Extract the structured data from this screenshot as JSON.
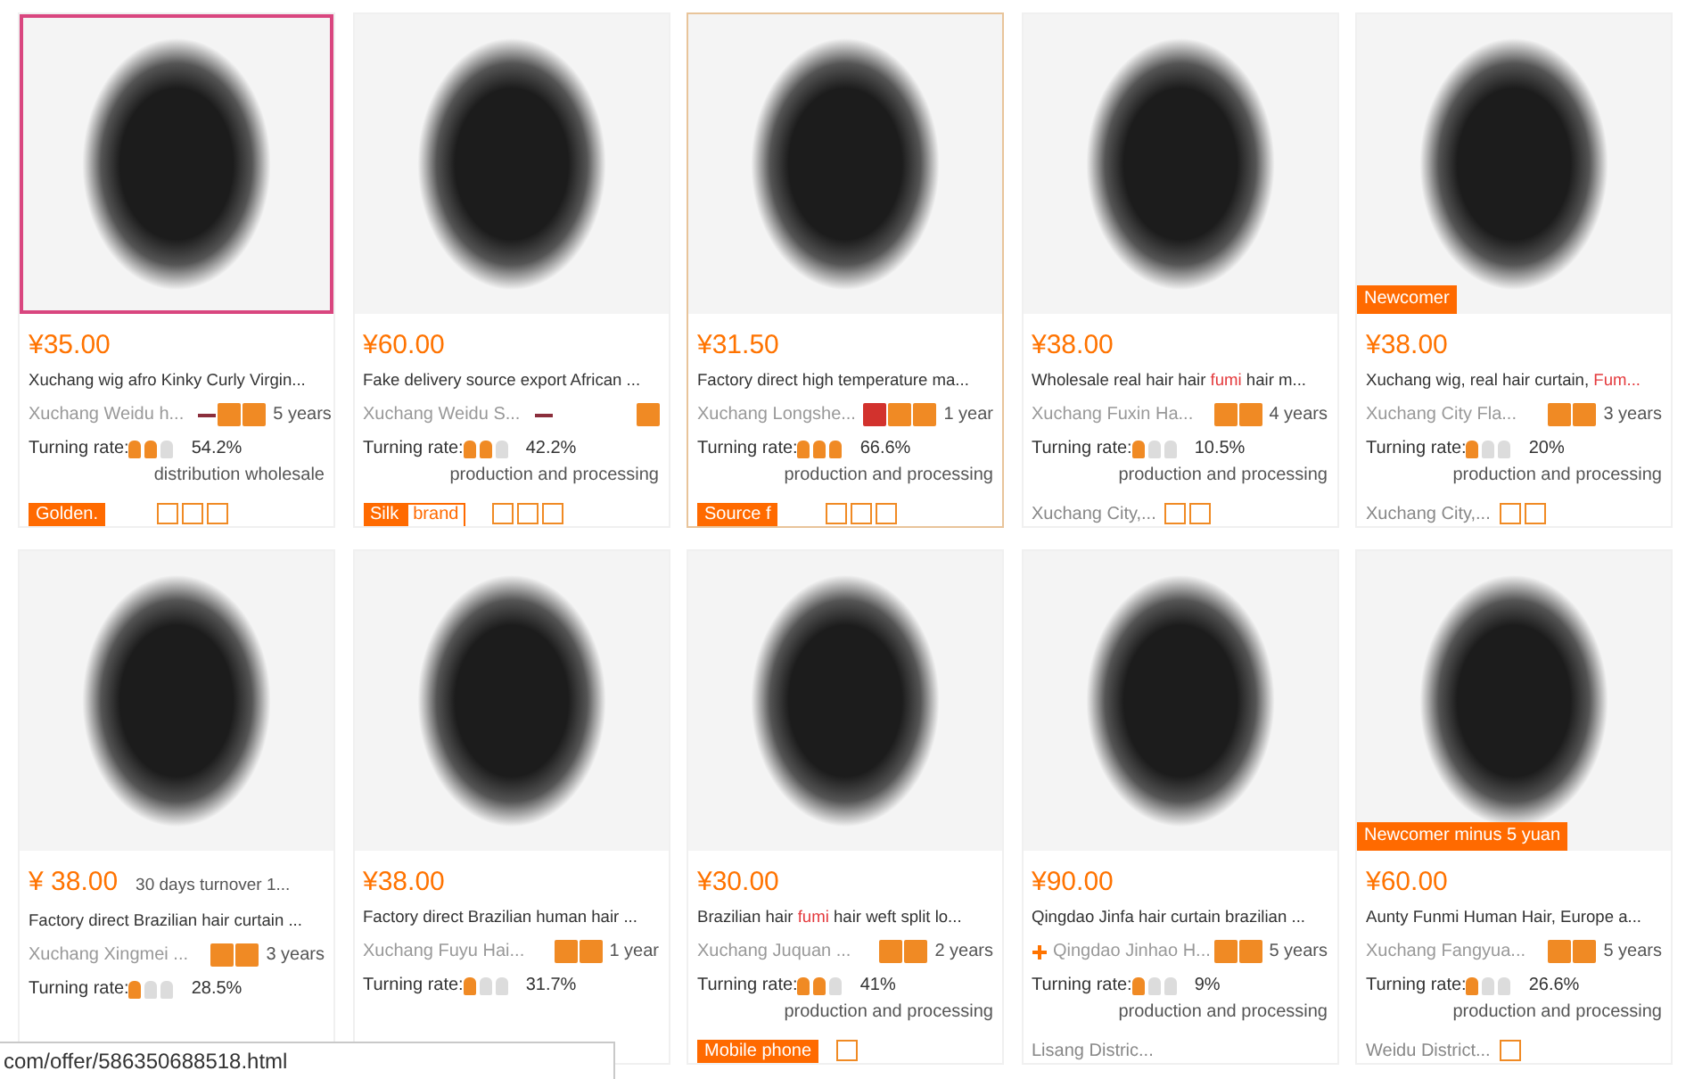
{
  "products": [
    {
      "selected": false,
      "image_framed": true,
      "price": "¥35.00",
      "title": [
        {
          "text": "Xuchang wig afro Kinky Curly Virgin...",
          "highlight": false
        }
      ],
      "company": "Xuchang Weidu h...",
      "company_mark": true,
      "trust_badges": [
        {
          "kind": "orange"
        },
        {
          "kind": "orange"
        }
      ],
      "years": "5 years",
      "rate_label": "Turning rate:",
      "stars": 2,
      "rate": "54.2%",
      "business": "distribution wholesale",
      "tag": [
        {
          "text": "Golden.",
          "kind": "filled"
        }
      ],
      "service_icons": [
        {
          "kind": "outline"
        },
        {
          "kind": "outline"
        },
        {
          "kind": "outline"
        }
      ]
    },
    {
      "selected": false,
      "image_framed": false,
      "price": "¥60.00",
      "title": [
        {
          "text": "Fake delivery source export African ...",
          "highlight": false
        }
      ],
      "company": "Xuchang Weidu S...",
      "company_mark": true,
      "trust_badges": [
        {
          "kind": "orange"
        }
      ],
      "rate_label": "Turning rate:",
      "stars": 2,
      "rate": "42.2%",
      "business": "production and processing",
      "tag": [
        {
          "text": "Silk",
          "kind": "filled"
        },
        {
          "text": "brand",
          "kind": "outline"
        }
      ],
      "service_icons": [
        {
          "kind": "outline"
        },
        {
          "kind": "outline"
        },
        {
          "kind": "outline"
        }
      ]
    },
    {
      "selected": true,
      "image_framed": false,
      "price": "¥31.50",
      "title": [
        {
          "text": "Factory direct high temperature ma...",
          "highlight": false
        }
      ],
      "company": "Xuchang Longshe...",
      "trust_badges": [
        {
          "kind": "red"
        },
        {
          "kind": "orange"
        },
        {
          "kind": "orange"
        }
      ],
      "years": "1 year",
      "rate_label": "Turning rate:",
      "stars": 3,
      "rate": "66.6%",
      "business": "production and processing",
      "tag": [
        {
          "text": "Source f",
          "kind": "filled"
        }
      ],
      "service_icons": [
        {
          "kind": "outline"
        },
        {
          "kind": "outline"
        },
        {
          "kind": "outline"
        }
      ]
    },
    {
      "selected": false,
      "image_framed": false,
      "price": "¥38.00",
      "title": [
        {
          "text": "Wholesale real hair hair ",
          "highlight": false
        },
        {
          "text": "fumi",
          "highlight": true
        },
        {
          "text": " hair m...",
          "highlight": false
        }
      ],
      "company": "Xuchang Fuxin Ha...",
      "trust_badges": [
        {
          "kind": "orange"
        },
        {
          "kind": "orange"
        }
      ],
      "years": "4 years",
      "rate_label": "Turning rate:",
      "stars": 1,
      "rate": "10.5%",
      "business": "production and processing",
      "location": "Xuchang City,...",
      "service_icons": [
        {
          "kind": "outline"
        },
        {
          "kind": "outline"
        }
      ]
    },
    {
      "selected": false,
      "image_framed": false,
      "image_badge": "Newcomer",
      "price": "¥38.00",
      "title": [
        {
          "text": "Xuchang wig, real hair curtain, ",
          "highlight": false
        },
        {
          "text": "Fum...",
          "highlight": true
        }
      ],
      "company": "Xuchang City Fla...",
      "trust_badges": [
        {
          "kind": "orange"
        },
        {
          "kind": "orange"
        }
      ],
      "years": "3 years",
      "rate_label": "Turning rate:",
      "stars": 1,
      "rate": "20%",
      "business": "production and processing",
      "location": "Xuchang City,...",
      "service_icons": [
        {
          "kind": "outline"
        },
        {
          "kind": "outline"
        }
      ]
    },
    {
      "selected": false,
      "image_framed": false,
      "price": "¥ 38.00",
      "turnover": "30 days turnover 1...",
      "title": [
        {
          "text": "Factory direct Brazilian hair curtain ...",
          "highlight": false
        }
      ],
      "company": "Xuchang Xingmei ...",
      "trust_badges": [
        {
          "kind": "orange"
        },
        {
          "kind": "orange"
        }
      ],
      "years": "3 years",
      "rate_label": "Turning rate:",
      "stars": 1,
      "rate": "28.5%"
    },
    {
      "selected": false,
      "image_framed": false,
      "price": "¥38.00",
      "title": [
        {
          "text": "Factory direct Brazilian human hair ...",
          "highlight": false
        }
      ],
      "company": "Xuchang Fuyu Hai...",
      "trust_badges": [
        {
          "kind": "orange"
        },
        {
          "kind": "orange"
        }
      ],
      "years": "1 year",
      "rate_label": "Turning rate:",
      "stars": 1,
      "rate": "31.7%"
    },
    {
      "selected": false,
      "image_framed": false,
      "price": "¥30.00",
      "title": [
        {
          "text": "Brazilian hair ",
          "highlight": false
        },
        {
          "text": "fumi",
          "highlight": true
        },
        {
          "text": " hair weft split lo...",
          "highlight": false
        }
      ],
      "company": "Xuchang Juquan ...",
      "trust_badges": [
        {
          "kind": "orange"
        },
        {
          "kind": "orange"
        }
      ],
      "years": "2 years",
      "rate_label": "Turning rate:",
      "stars": 2,
      "rate": "41%",
      "business": "production and processing",
      "tag": [
        {
          "text": "Mobile phone",
          "kind": "filled"
        }
      ],
      "service_icons": [
        {
          "kind": "outline"
        }
      ]
    },
    {
      "selected": false,
      "image_framed": false,
      "price": "¥90.00",
      "title": [
        {
          "text": "Qingdao Jinfa hair curtain brazilian ...",
          "highlight": false
        }
      ],
      "company_plus": true,
      "company": "Qingdao Jinhao H...",
      "trust_badges": [
        {
          "kind": "orange"
        },
        {
          "kind": "orange"
        }
      ],
      "years": "5 years",
      "rate_label": "Turning rate:",
      "stars": 1,
      "rate": "9%",
      "business": "production and processing",
      "location": "Lisang Distric..."
    },
    {
      "selected": false,
      "image_framed": false,
      "image_badge": "Newcomer minus 5 yuan",
      "price": "¥60.00",
      "title": [
        {
          "text": "Aunty Funmi Human Hair, Europe a...",
          "highlight": false
        }
      ],
      "company": "Xuchang Fangyua...",
      "trust_badges": [
        {
          "kind": "orange"
        },
        {
          "kind": "orange"
        }
      ],
      "years": "5 years",
      "rate_label": "Turning rate:",
      "stars": 1,
      "rate": "26.6%",
      "business": "production and processing",
      "location": "Weidu District...",
      "service_icons": [
        {
          "kind": "outline"
        }
      ]
    }
  ],
  "status_bar": {
    "url": "com/offer/586350688518.html"
  }
}
